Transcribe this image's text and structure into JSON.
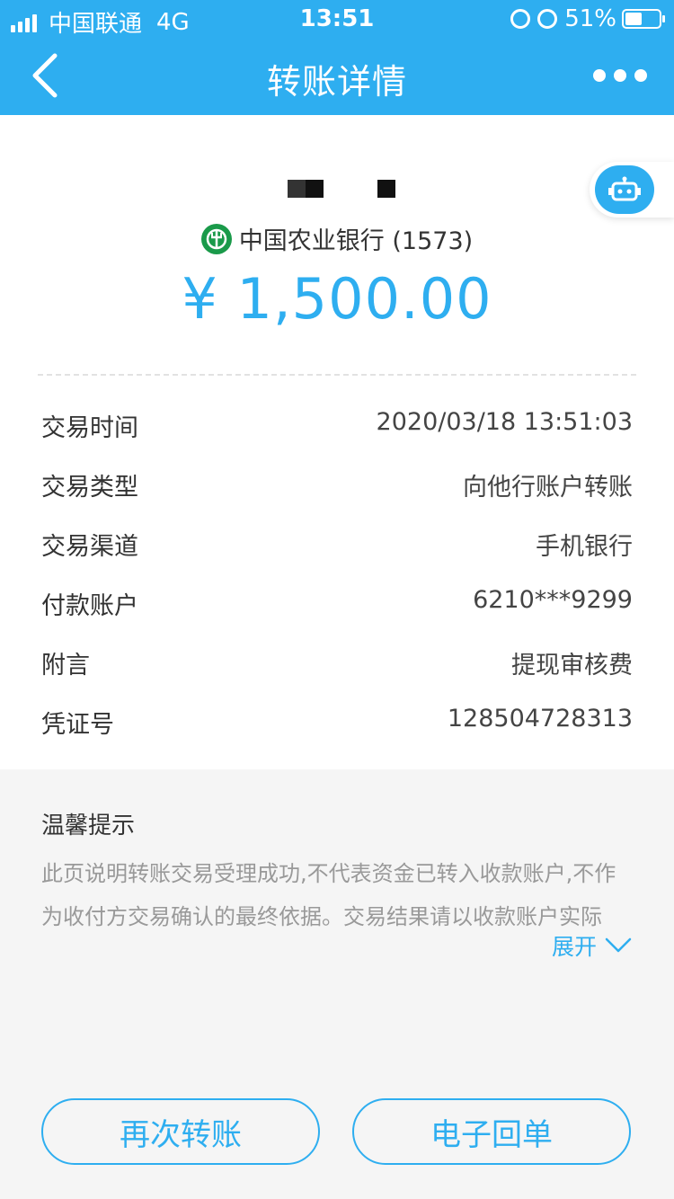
{
  "status_bar": {
    "carrier": "中国联通",
    "network": "4G",
    "time": "13:51",
    "battery": "51%"
  },
  "nav": {
    "title": "转账详情"
  },
  "payee": {
    "bank": "中国农业银行 (1573)",
    "amount": "¥ 1,500.00"
  },
  "details": [
    {
      "label": "交易时间",
      "value": "2020/03/18 13:51:03"
    },
    {
      "label": "交易类型",
      "value": "向他行账户转账"
    },
    {
      "label": "交易渠道",
      "value": "手机银行"
    },
    {
      "label": "付款账户",
      "value": "6210***9299"
    },
    {
      "label": "附言",
      "value": "提现审核费"
    },
    {
      "label": "凭证号",
      "value": "128504728313"
    }
  ],
  "tips": {
    "title": "温馨提示",
    "line1": "此页说明转账交易受理成功,不代表资金已转入收款账户,不作",
    "line2": "为收付方交易确认的最终依据。交易结果请以收款账户实际",
    "expand_label": "展开"
  },
  "buttons": {
    "transfer_again": "再次转账",
    "e_receipt": "电子回单"
  },
  "colors": {
    "accent": "#2eaef0",
    "bank_logo": "#1a9a4a"
  }
}
